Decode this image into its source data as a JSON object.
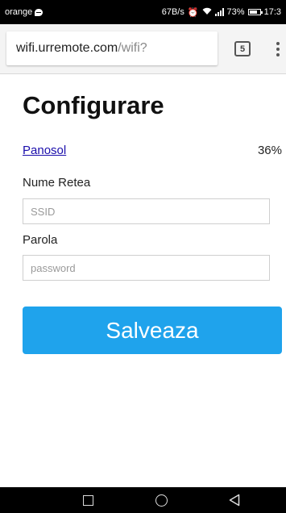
{
  "status_bar": {
    "carrier": "orange",
    "speed": "67B/s",
    "battery_percent": "73%",
    "time": "17:3",
    "icons": [
      "message-icon",
      "alarm-icon",
      "wifi-icon",
      "signal-icon",
      "battery-icon"
    ]
  },
  "browser": {
    "url_host": "wifi.urremote.com",
    "url_path": "/wifi?",
    "tab_count": "5",
    "menu_icon": "more-vertical-icon"
  },
  "page": {
    "title": "Configurare",
    "network": {
      "name": "Panosol",
      "signal": "36%"
    },
    "ssid_label": "Nume Retea",
    "ssid_placeholder": "SSID",
    "ssid_value": "",
    "password_label": "Parola",
    "password_placeholder": "password",
    "password_value": "",
    "save_label": "Salveaza",
    "accent_color": "#1fa3ec",
    "link_color": "#1a0dab"
  },
  "nav_bar": {
    "buttons": [
      "recents-icon",
      "home-icon",
      "back-icon"
    ]
  }
}
